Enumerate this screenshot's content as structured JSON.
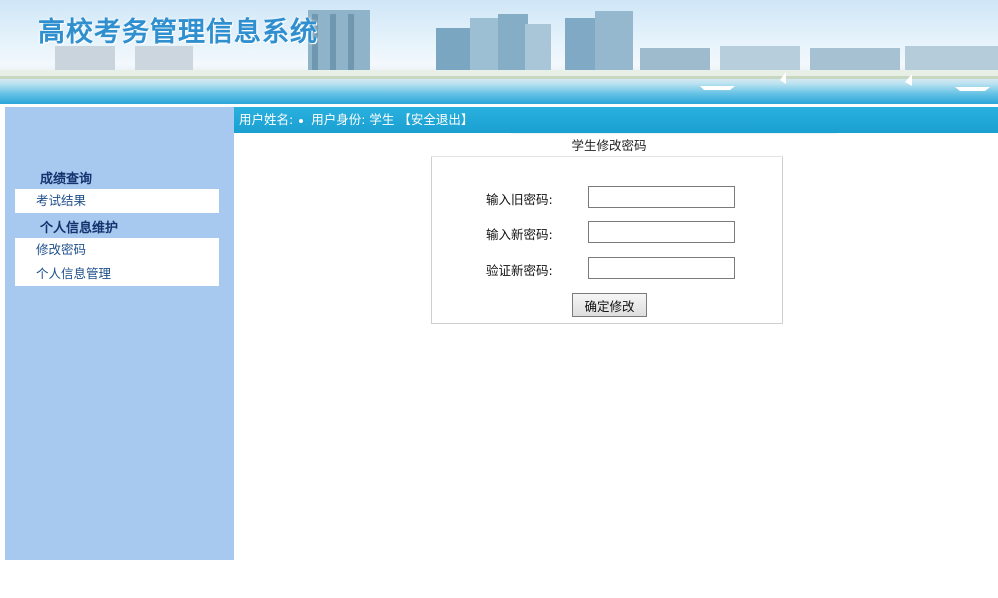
{
  "header": {
    "title": "高校考务管理信息系统"
  },
  "infobar": {
    "username_label": "用户姓名:",
    "role_label": "用户身份:",
    "role_value": "学生",
    "logout_label": "【安全退出】"
  },
  "sidebar": {
    "groups": [
      {
        "title": "成绩查询",
        "items": [
          {
            "label": "考试结果"
          }
        ]
      },
      {
        "title": "个人信息维护",
        "items": [
          {
            "label": "修改密码"
          },
          {
            "label": "个人信息管理"
          }
        ]
      }
    ]
  },
  "form": {
    "title": "学生修改密码",
    "old_password_label": "输入旧密码:",
    "new_password_label": "输入新密码:",
    "confirm_password_label": "验证新密码:",
    "old_password_value": "",
    "new_password_value": "",
    "confirm_password_value": "",
    "submit_label": "确定修改"
  },
  "colors": {
    "sidebar_bg": "#a7c8ef",
    "infobar_bg": "#1a9fd1",
    "title_blue": "#2f8fcf",
    "group_title": "#13326e",
    "link": "#1e4f8a"
  }
}
